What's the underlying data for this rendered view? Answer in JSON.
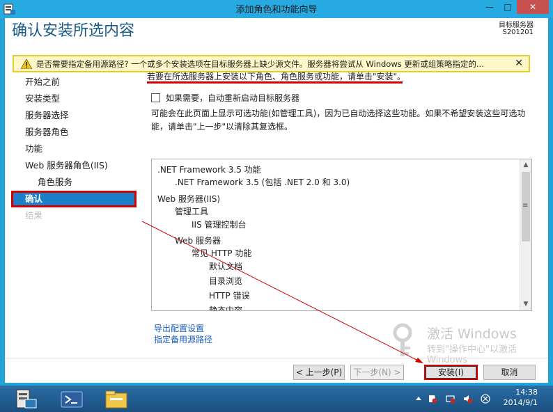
{
  "window": {
    "title": "添加角色和功能向导",
    "minimize_label": "—",
    "maximize_label": "□",
    "close_label": "✕"
  },
  "header": {
    "title": "确认安装所选内容",
    "dest_server_label": "目标服务器",
    "dest_server_name": "S201201"
  },
  "warning": {
    "text": "是否需要指定备用源路径? 一个或多个安装选项在目标服务器上缺少源文件。服务器将尝试从 Windows 更新或组策略指定的...",
    "close_label": "✕"
  },
  "nav": {
    "items": [
      {
        "label": "开始之前"
      },
      {
        "label": "安装类型"
      },
      {
        "label": "服务器选择"
      },
      {
        "label": "服务器角色"
      },
      {
        "label": "功能"
      },
      {
        "label": "Web 服务器角色(IIS)"
      },
      {
        "label": "角色服务"
      },
      {
        "label": "确认"
      },
      {
        "label": "结果"
      }
    ]
  },
  "main": {
    "instruction": "若要在所选服务器上安装以下角色、角色服务或功能，请单击\"安装\"。",
    "restart_label": "如果需要，自动重新启动目标服务器",
    "info_text": "可能会在此页面上显示可选功能(如管理工具)，因为已自动选择这些功能。如果不希望安装这些可选功能，请单击\"上一步\"以清除其复选框。",
    "features": [
      ".NET Framework 3.5 功能",
      ".NET Framework 3.5 (包括 .NET 2.0 和 3.0)",
      "Web 服务器(IIS)",
      "管理工具",
      "IIS 管理控制台",
      "Web 服务器",
      "常见 HTTP 功能",
      "默认文档",
      "目录浏览",
      "HTTP 错误",
      "静态内容"
    ],
    "export_link": "导出配置设置",
    "alt_source_link": "指定备用源路径"
  },
  "watermark": {
    "title": "激活 Windows",
    "subtitle": "转到\"操作中心\"以激活",
    "subtitle2": "Windows"
  },
  "buttons": {
    "prev": "< 上一步(P)",
    "next": "下一步(N) >",
    "install": "安装(I)",
    "cancel": "取消"
  },
  "taskbar": {
    "time": "14:38",
    "date": "2014/9/1"
  },
  "colors": {
    "accent": "#1e7fc9",
    "highlight": "#d40000",
    "title_bar": "#27a9e1"
  }
}
